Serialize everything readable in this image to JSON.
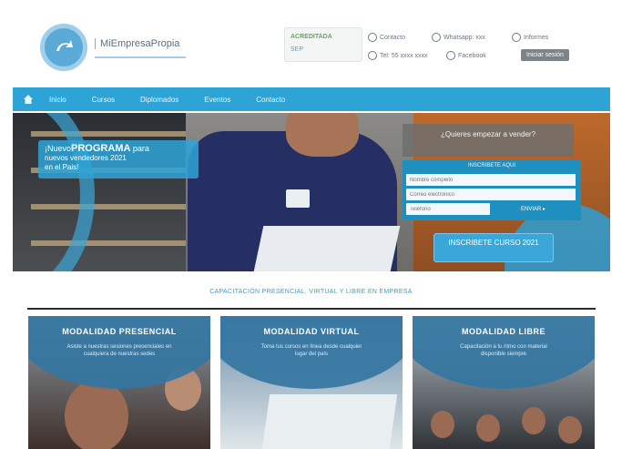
{
  "header": {
    "logo_text": "MiEmpresaPropia",
    "badge": {
      "line1": "ACREDITADA",
      "line2": "SEP"
    },
    "contacts": [
      {
        "label": "Contacto"
      },
      {
        "label": "Whatsapp: xxx"
      },
      {
        "label": "Informes"
      },
      {
        "label": "Tel: 55 xxxx xxxx"
      },
      {
        "label": "Facebook"
      },
      {
        "label": "Iniciar sesión"
      }
    ]
  },
  "nav": {
    "items": [
      "Inicio",
      "Cursos",
      "Diplomados",
      "Eventos",
      "Contacto"
    ]
  },
  "hero": {
    "promo_line1_prefix": "¡Nuevo",
    "promo_line1_bold": "PROGRAMA",
    "promo_line1_suffix": "para",
    "promo_line2": "nuevos vendedores 2021",
    "promo_line3": "en el Pais!",
    "form_question": "¿Quieres empezar a vender?",
    "form_title": "INSCRIBETE AQUI",
    "form_placeholder_name": "Nombre completo",
    "form_placeholder_email": "Correo electrónico",
    "form_placeholder_phone": "Teléfono",
    "form_button": "ENVIAR ▸",
    "cta_label": "INSCRIBETE CURSO 2021"
  },
  "headline": "CAPACITACIÓN PRESENCIAL, VIRTUAL Y LIBRE EN EMPRESA",
  "cards": [
    {
      "title": "MODALIDAD PRESENCIAL",
      "desc": "Asiste a nuestras sesiones presenciales en cualquiera de nuestras sedes"
    },
    {
      "title": "MODALIDAD VIRTUAL",
      "desc": "Toma tus cursos en línea desde cualquier lugar del país"
    },
    {
      "title": "MODALIDAD LIBRE",
      "desc": "Capacitación a tu ritmo con material disponible siempre"
    }
  ],
  "colors": {
    "accent": "#2ea3d6",
    "card_overlay": "#3476a2",
    "rule": "#2b2b2b"
  }
}
